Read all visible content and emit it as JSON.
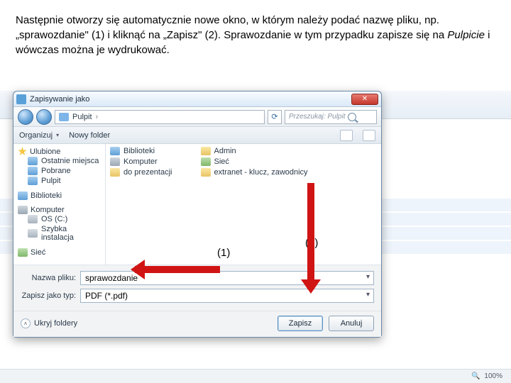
{
  "instruction_html": "Następnie otworzy się automatycznie nowe okno, w którym należy podać nazwę pliku, np. „sprawozdanie\" (1) i kliknąć na „Zapisz\" (2). Sprawozdanie w tym przypadku zapisze się na <em>Pulpicie</em> i wówczas można je wydrukować.",
  "dialog": {
    "title": "Zapisywanie jako",
    "breadcrumb_location": "Pulpit",
    "breadcrumb_sep": "›",
    "search_placeholder": "Przeszukaj: Pulpit",
    "toolbar": {
      "organize": "Organizuj",
      "newfolder": "Nowy folder"
    },
    "sidebar": {
      "favorites": {
        "label": "Ulubione",
        "items": [
          "Ostatnie miejsca",
          "Pobrane",
          "Pulpit"
        ]
      },
      "libraries": {
        "label": "Biblioteki"
      },
      "computer": {
        "label": "Komputer",
        "items": [
          "OS (C:)",
          "Szybka instalacja"
        ]
      },
      "network": {
        "label": "Sieć"
      }
    },
    "content": {
      "col1": [
        "Biblioteki",
        "Komputer",
        "do prezentacji"
      ],
      "col2": [
        "Admin",
        "Sieć",
        "extranet - klucz, zawodnicy"
      ]
    },
    "form": {
      "filename_label": "Nazwa pliku:",
      "filename_value": "sprawozdanie",
      "type_label": "Zapisz jako typ:",
      "type_value": "PDF (*.pdf)"
    },
    "footer": {
      "hide_folders": "Ukryj foldery",
      "save": "Zapisz",
      "cancel": "Anuluj"
    }
  },
  "annotations": {
    "one": "(1)",
    "two": "(2)"
  },
  "statusbar": {
    "zoom": "100%"
  }
}
